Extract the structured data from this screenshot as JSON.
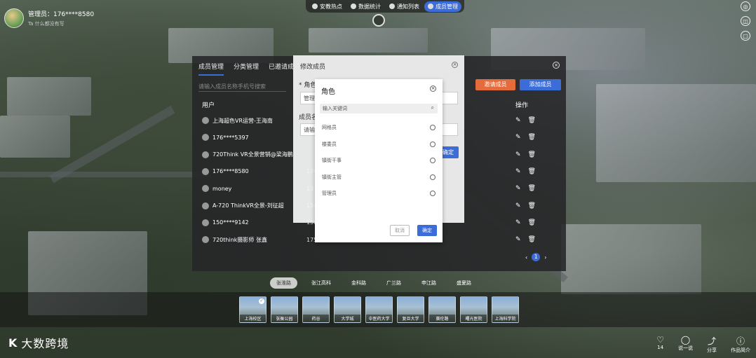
{
  "user": {
    "name": "管理员：176****8580",
    "subtitle": "Ta 什么都没有写"
  },
  "topnav": [
    {
      "label": "安教热点",
      "active": false
    },
    {
      "label": "数据统计",
      "active": false
    },
    {
      "label": "通知列表",
      "active": false
    },
    {
      "label": "成员管理",
      "active": true
    }
  ],
  "panel": {
    "tabs": [
      "成员管理",
      "分类管理",
      "已邀请成"
    ],
    "search_placeholder": "请输入成员名称手机号搜索",
    "invite_label": "邀请成员",
    "add_label": "添加成员",
    "col_user": "用户",
    "col_op": "操作",
    "rows": [
      {
        "name": "上海超色VR运营-王海南",
        "phone": ""
      },
      {
        "name": "176****5397",
        "phone": ""
      },
      {
        "name": "720Think VR全景营销@梁海鹏",
        "phone": ""
      },
      {
        "name": "176****8580",
        "phone": "176"
      },
      {
        "name": "money",
        "phone": "137"
      },
      {
        "name": "A-720 ThinkVR全景-刘征超",
        "phone": "156"
      },
      {
        "name": "150****9142",
        "phone": "150"
      },
      {
        "name": "720think摄影师 张鑫",
        "phone": "175"
      }
    ],
    "page_current": "1",
    "page_prev": "‹",
    "page_next": "›"
  },
  "edit_modal": {
    "title": "修改成员",
    "role_label": "* 角色",
    "role_value": "管理",
    "name_label": "成员名",
    "name_placeholder": "请输",
    "ok": "确定"
  },
  "role_modal": {
    "title": "角色",
    "search_placeholder": "输入关键词",
    "options": [
      "网格员",
      "楼委员",
      "镇街干事",
      "镇街主管",
      "管理员"
    ],
    "cancel": "取消",
    "ok": "确定"
  },
  "scene_tabs": [
    {
      "label": "张淮路",
      "active": true
    },
    {
      "label": "张江高科",
      "active": false
    },
    {
      "label": "金科路",
      "active": false
    },
    {
      "label": "广兰路",
      "active": false
    },
    {
      "label": "申江路",
      "active": false
    },
    {
      "label": "盛夏路",
      "active": false
    }
  ],
  "thumbs": [
    {
      "label": "上海校区",
      "checked": true
    },
    {
      "label": "张衡公园",
      "checked": false
    },
    {
      "label": "药谷",
      "checked": false
    },
    {
      "label": "大学城",
      "checked": false
    },
    {
      "label": "中医药大学",
      "checked": false
    },
    {
      "label": "复旦大学",
      "checked": false
    },
    {
      "label": "赛伦路",
      "checked": false
    },
    {
      "label": "曙光医院",
      "checked": false
    },
    {
      "label": "上海科学院",
      "checked": false
    }
  ],
  "brand": {
    "mark": "K",
    "name": "大数跨境"
  },
  "bottom_actions": [
    {
      "icon": "heart-icon",
      "glyph": "♡",
      "label": "14"
    },
    {
      "icon": "comment-icon",
      "glyph": "◯",
      "label": "说一说"
    },
    {
      "icon": "share-icon",
      "glyph": "⤴",
      "label": "分享"
    },
    {
      "icon": "info-icon",
      "glyph": "ⓘ",
      "label": "作品简介"
    }
  ],
  "colors": {
    "accent": "#3c6cd8",
    "invite": "#e46b3c"
  }
}
